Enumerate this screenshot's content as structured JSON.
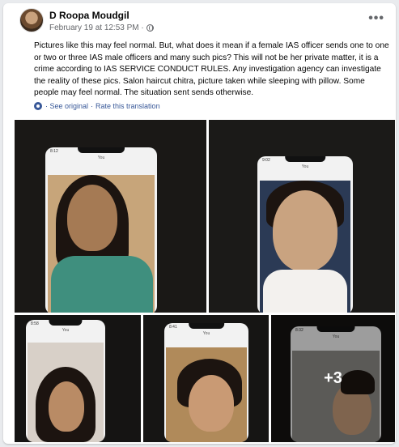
{
  "post": {
    "author": "D Roopa Moudgil",
    "timestamp": "February 19 at 12:53 PM ·",
    "more_label": "•••",
    "text": "Pictures like this may feel normal. But, what does it mean if a female IAS officer sends one to one or two or three IAS male officers and many such pics? This will not be her private matter, it is a crime according to IAS SERVICE CONDUCT RULES. Any investigation agency can investigate the reality of these pics. Salon haircut chitra, picture taken while sleeping with pillow. Some people may feel normal. The situation sent sends otherwise.",
    "see_original": "· See original",
    "separator": "·",
    "rate_translation": "Rate this translation"
  },
  "photos": {
    "phone_time": [
      "8:12",
      "9:02",
      "8:58",
      "8:41",
      "8:32"
    ],
    "chat_title": "You",
    "more_count": "+3"
  }
}
